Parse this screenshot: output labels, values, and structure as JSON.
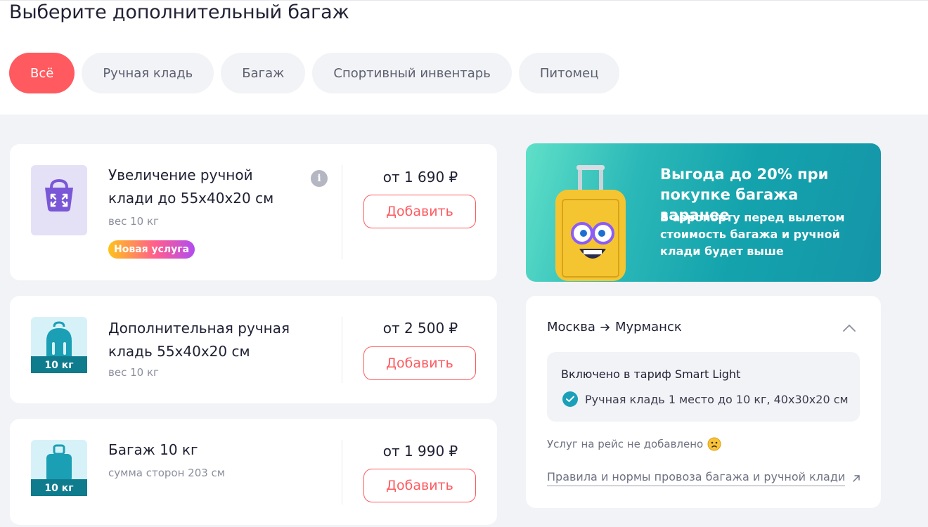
{
  "page": {
    "title": "Выберите дополнительный багаж"
  },
  "tabs": [
    {
      "label": "Всё",
      "active": true
    },
    {
      "label": "Ручная кладь",
      "active": false
    },
    {
      "label": "Багаж",
      "active": false
    },
    {
      "label": "Спортивный инвентарь",
      "active": false
    },
    {
      "label": "Питомец",
      "active": false
    }
  ],
  "items": [
    {
      "name": "Увеличение ручной клади до 55х40х20 см",
      "sub": "вес 10 кг",
      "badge": "Новая услуга",
      "price": "от 1 690 ₽",
      "button": "Добавить",
      "icon": "bag-expand-icon"
    },
    {
      "name": "Дополнительная ручная кладь 55х40х20 см",
      "sub": "вес 10 кг",
      "icon_label": "10 кг",
      "price": "от 2 500 ₽",
      "button": "Добавить",
      "icon": "backpack-icon"
    },
    {
      "name": "Багаж 10 кг",
      "sub": "сумма сторон 203 см",
      "icon_label": "10 кг",
      "price": "от 1 990 ₽",
      "button": "Добавить",
      "icon": "suitcase-icon"
    }
  ],
  "promo": {
    "title": "Выгода до 20% при покупке багажа заранее",
    "text": "В аэропорту перед вылетом стоимость багажа и ручной клади будет выше"
  },
  "route": {
    "from": "Москва",
    "to": "Мурманск",
    "included_title": "Включено в тариф Smart Light",
    "included_item": "Ручная кладь 1 место до 10 кг, 40х30х20 см",
    "no_services": "Услуг на рейс не добавлено",
    "rules_link": "Правила и нормы провоза багажа и ручной клади"
  },
  "colors": {
    "accent": "#ff5a5f",
    "teal": "#1aa0b8",
    "background": "#f1f3f7"
  }
}
